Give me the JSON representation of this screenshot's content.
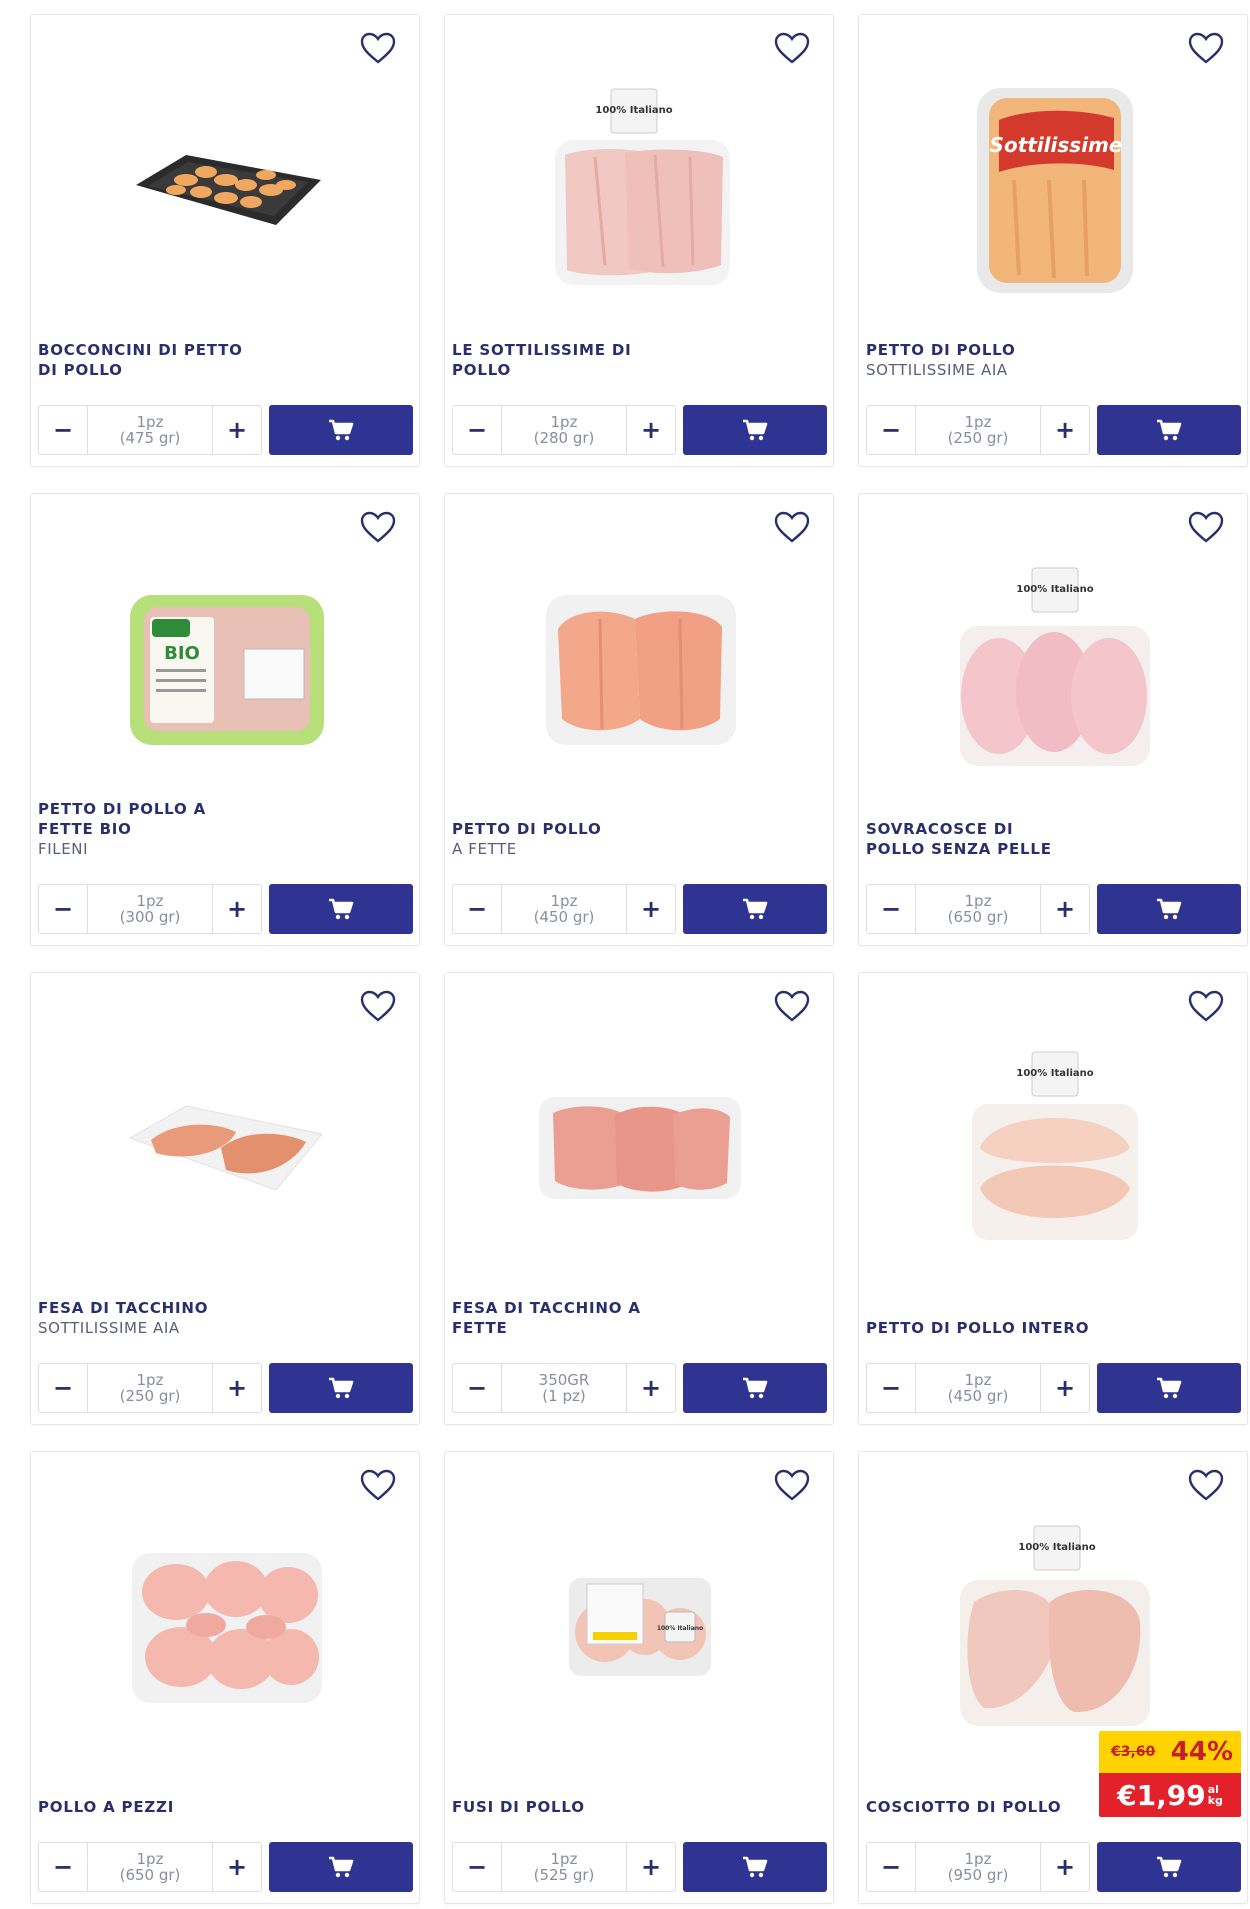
{
  "colors": {
    "brand_navy": "#2f3391",
    "text_navy": "#2a2f6b",
    "promo_yellow": "#ffd200",
    "promo_red": "#e2212a"
  },
  "icons": {
    "favorite": "heart-outline-icon",
    "cart": "shopping-cart-icon"
  },
  "qty_controls": {
    "minus": "−",
    "plus": "+"
  },
  "products": [
    {
      "name": "BOCCONCINI DI PETTO DI POLLO",
      "brand": "",
      "qty_main": "1pz",
      "qty_sub": "(475 gr)"
    },
    {
      "name": "LE SOTTILISSIME DI POLLO",
      "brand": "",
      "qty_main": "1pz",
      "qty_sub": "(280 gr)",
      "image_label": "100% Italiano"
    },
    {
      "name": "PETTO DI POLLO",
      "brand": "SOTTILISSIME AIA",
      "qty_main": "1pz",
      "qty_sub": "(250 gr)",
      "image_label": "Sottilissime"
    },
    {
      "name": "PETTO DI POLLO A FETTE BIO",
      "brand": "FILENI",
      "qty_main": "1pz",
      "qty_sub": "(300 gr)",
      "image_label": "BIO"
    },
    {
      "name": "PETTO DI POLLO",
      "brand": "A FETTE",
      "qty_main": "1pz",
      "qty_sub": "(450 gr)"
    },
    {
      "name": "SOVRACOSCE DI POLLO SENZA PELLE",
      "brand": "",
      "qty_main": "1pz",
      "qty_sub": "(650 gr)",
      "image_label": "100% Italiano"
    },
    {
      "name": "FESA DI TACCHINO",
      "brand": "SOTTILISSIME AIA",
      "qty_main": "1pz",
      "qty_sub": "(250 gr)"
    },
    {
      "name": "FESA DI TACCHINO A FETTE",
      "brand": "",
      "qty_main": "350GR",
      "qty_sub": "(1 pz)"
    },
    {
      "name": "PETTO DI POLLO INTERO",
      "brand": "",
      "qty_main": "1pz",
      "qty_sub": "(450 gr)",
      "image_label": "100% Italiano"
    },
    {
      "name": "POLLO A PEZZI",
      "brand": "",
      "qty_main": "1pz",
      "qty_sub": "(650 gr)"
    },
    {
      "name": "FUSI DI POLLO",
      "brand": "",
      "qty_main": "1pz",
      "qty_sub": "(525 gr)",
      "image_label": "100% Italiano"
    },
    {
      "name": "COSCIOTTO DI POLLO",
      "brand": "",
      "qty_main": "1pz",
      "qty_sub": "(950 gr)",
      "image_label": "100% Italiano",
      "promo": {
        "old_price": "€3,60",
        "discount": "44%",
        "new_price": "€1,99",
        "unit_top": "al",
        "unit_bottom": "kg"
      }
    }
  ]
}
